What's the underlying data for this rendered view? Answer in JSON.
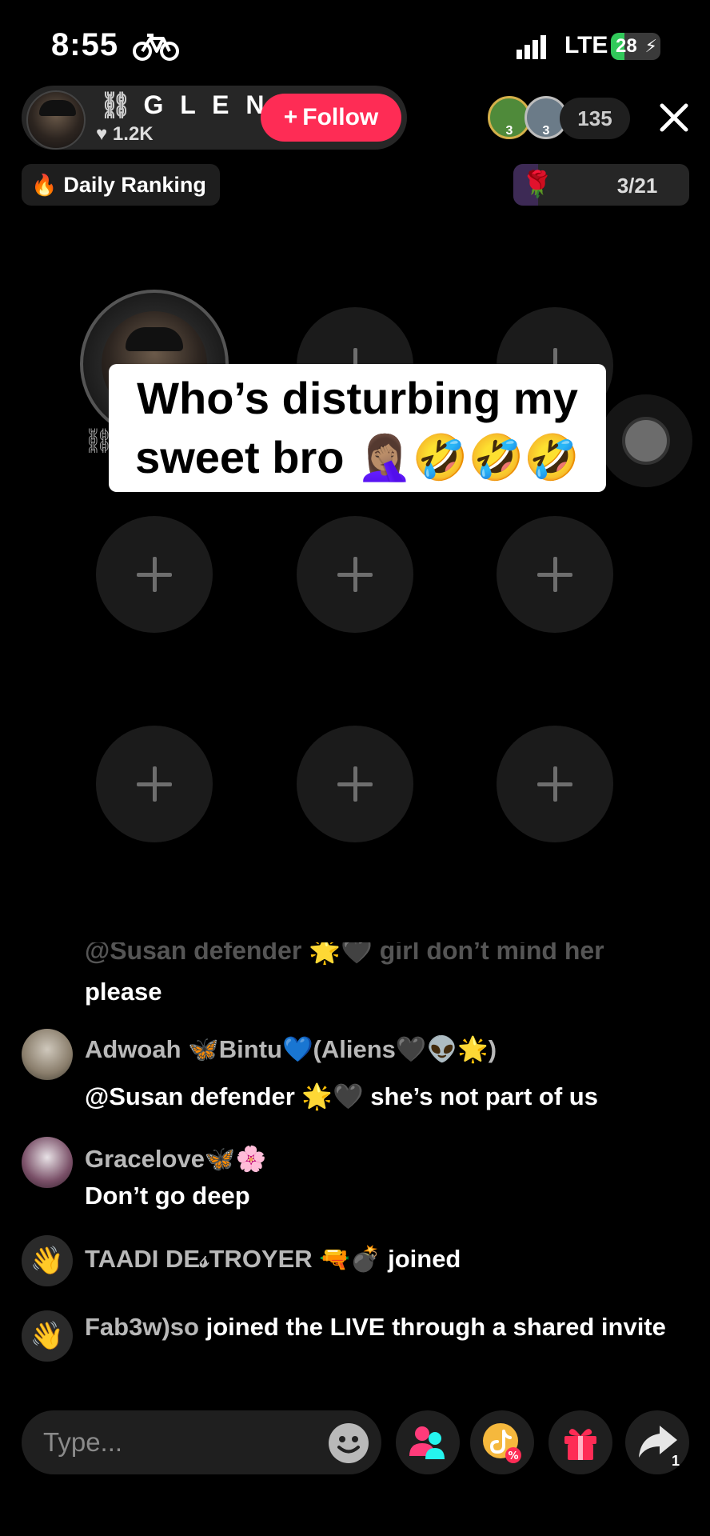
{
  "status_bar": {
    "time": "8:55",
    "network": "LTE",
    "battery": "28",
    "battery_level": 0.28
  },
  "host": {
    "name": "G L E N...",
    "likes": "1.2K",
    "follow_label": "Follow",
    "follow_plus": "+"
  },
  "top_viewers": [
    {
      "rank": "3"
    },
    {
      "rank": "3"
    }
  ],
  "viewer_count": "135",
  "daily_ranking": {
    "label": "Daily Ranking"
  },
  "goal": {
    "count": "3/21",
    "progress": 0.14
  },
  "caption": {
    "line1": "Who’s disturbing my",
    "line2": "sweet bro 🤦🏽‍♀️🤣🤣🤣"
  },
  "comments": {
    "faded": "@Susan defender 🌟🖤 girl don’t mind her",
    "continuation": "please",
    "items": [
      {
        "name": "Adwoah 🦋Bintu💙(Aliens🖤👽🌟)",
        "text": "@Susan defender 🌟🖤 she’s not part of us"
      },
      {
        "name": "Gracelove🦋🌸",
        "text": "Don’t go deep"
      }
    ],
    "joins": [
      {
        "who": "TAADI DE𝓈TROYER 🔫💣",
        "text": " joined"
      },
      {
        "who": "Fab3w)so",
        "text": " joined the LIVE through a shared invite"
      }
    ]
  },
  "bottom_bar": {
    "placeholder": "Type...",
    "share_count": "1"
  }
}
